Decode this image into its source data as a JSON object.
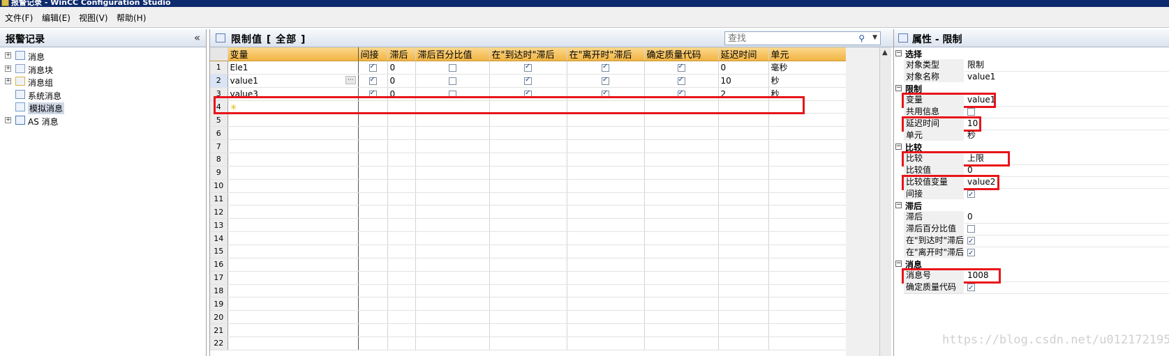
{
  "window": {
    "title": "报警记录 - WinCC Configuration Studio"
  },
  "menu": [
    "文件(F)",
    "编辑(E)",
    "视图(V)",
    "帮助(H)"
  ],
  "left_pane": {
    "title": "报警记录",
    "collapse_glyph": "«",
    "items": [
      {
        "label": "消息",
        "icon": "message-icon",
        "expandable": true
      },
      {
        "label": "消息块",
        "icon": "message-block-icon",
        "expandable": true
      },
      {
        "label": "消息组",
        "icon": "message-group-icon",
        "expandable": true
      },
      {
        "label": "系统消息",
        "icon": "system-message-icon",
        "expandable": false
      },
      {
        "label": "模拟消息",
        "icon": "analog-message-icon",
        "expandable": false,
        "selected": true
      },
      {
        "label": "AS 消息",
        "icon": "as-message-icon",
        "expandable": true
      }
    ]
  },
  "center_pane": {
    "title": "限制值 [ 全部 ]",
    "search_placeholder": "查找",
    "columns": [
      "变量",
      "间接",
      "滞后",
      "滞后百分比值",
      "在\"到达时\"滞后",
      "在\"离开时\"滞后",
      "确定质量代码",
      "延迟时间",
      "单元"
    ],
    "rows": [
      {
        "num": "1",
        "variable": "Ele1",
        "indirect": true,
        "hysteresis": "0",
        "hyst_percent": false,
        "on_arrival": true,
        "on_departure": true,
        "quality_code": true,
        "delay": "0",
        "unit": "毫秒"
      },
      {
        "num": "2",
        "variable": "value1",
        "indirect": true,
        "hysteresis": "0",
        "hyst_percent": false,
        "on_arrival": true,
        "on_departure": true,
        "quality_code": true,
        "delay": "10",
        "unit": "秒",
        "editing": true
      },
      {
        "num": "3",
        "variable": "value3",
        "indirect": true,
        "hysteresis": "0",
        "hyst_percent": false,
        "on_arrival": true,
        "on_departure": true,
        "quality_code": true,
        "delay": "2",
        "unit": "秒"
      }
    ],
    "empty_rows": [
      "4",
      "5",
      "6",
      "7",
      "8",
      "9",
      "10",
      "11",
      "12",
      "13",
      "14",
      "15",
      "16",
      "17",
      "18",
      "19",
      "20",
      "21",
      "22"
    ]
  },
  "right_pane": {
    "title": "属性 - 限制",
    "groups": [
      {
        "name": "选择",
        "props": [
          {
            "name": "对象类型",
            "value": "限制"
          },
          {
            "name": "对象名称",
            "value": "value1"
          }
        ]
      },
      {
        "name": "限制",
        "props": [
          {
            "name": "变量",
            "value": "value1",
            "highlight": true
          },
          {
            "name": "共用信息",
            "check": false
          },
          {
            "name": "延迟时间",
            "value": "10",
            "highlight": true
          },
          {
            "name": "单元",
            "value": "秒"
          }
        ]
      },
      {
        "name": "比较",
        "props": [
          {
            "name": "比较",
            "value": "上限",
            "highlight": true
          },
          {
            "name": "比较值",
            "value": "0"
          },
          {
            "name": "比较值变量",
            "value": "value2",
            "highlight": true
          },
          {
            "name": "间接",
            "check": true
          }
        ]
      },
      {
        "name": "滞后",
        "props": [
          {
            "name": "滞后",
            "value": "0"
          },
          {
            "name": "滞后百分比值",
            "check": false
          },
          {
            "name": "在\"到达时\"滞后",
            "check": true
          },
          {
            "name": "在\"离开时\"滞后",
            "check": true
          }
        ]
      },
      {
        "name": "消息",
        "props": [
          {
            "name": "消息号",
            "value": "1008",
            "highlight": true
          },
          {
            "name": "确定质量代码",
            "check": true
          }
        ]
      }
    ]
  },
  "watermark": "https://blog.csdn.net/u012172195",
  "colors": {
    "title_bar": "#0e2a6e",
    "column_header": "#f2b443",
    "highlight": "#e8141a"
  }
}
